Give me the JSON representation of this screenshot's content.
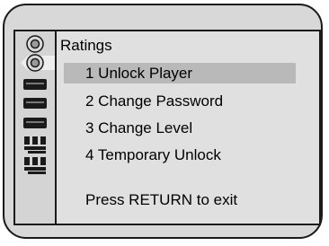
{
  "menu": {
    "title": "Ratings",
    "items": [
      {
        "label": "1 Unlock Player",
        "selected": true
      },
      {
        "label": "2 Change Password",
        "selected": false
      },
      {
        "label": "3 Change Level",
        "selected": false
      },
      {
        "label": "4 Temporary Unlock",
        "selected": false
      }
    ],
    "hint": "Press RETURN to exit"
  },
  "icons": [
    "disc-icon",
    "disc-icon-selected",
    "player-icon",
    "player-icon",
    "player-icon",
    "speaker-grid-icon",
    "speaker-grid-icon"
  ],
  "colors": {
    "selection": "#b9b9b9",
    "panel": "#e0e0e0",
    "frame": "#d8d8d8"
  }
}
